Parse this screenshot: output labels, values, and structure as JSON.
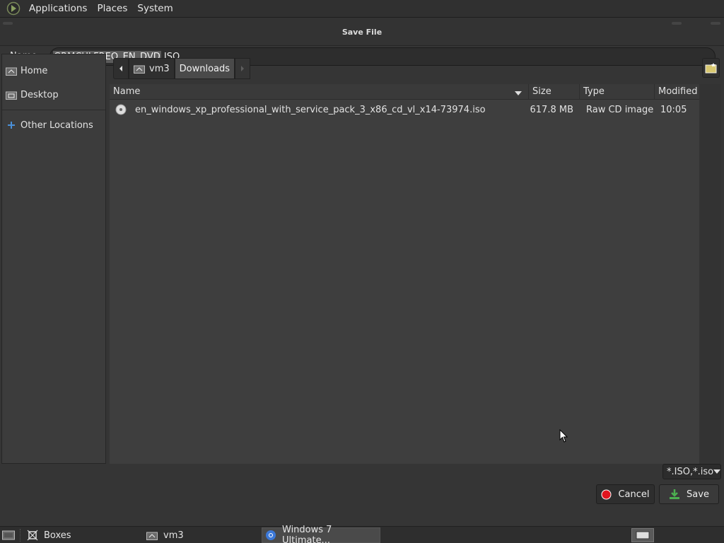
{
  "top_panel": {
    "menus": [
      "Applications",
      "Places",
      "System"
    ]
  },
  "dialog": {
    "title": "Save File",
    "name_label": "Name:",
    "name_value_selected": "GRMCULFREO_EN_DVD",
    "name_value_ext": ".ISO"
  },
  "sidebar": {
    "items": [
      {
        "label": "Home",
        "icon": "home-folder-icon"
      },
      {
        "label": "Desktop",
        "icon": "desktop-folder-icon"
      },
      {
        "label": "Other Locations",
        "icon": "plus-icon"
      }
    ]
  },
  "pathbar": {
    "segments": [
      "vm3",
      "Downloads"
    ]
  },
  "file_list": {
    "columns": [
      "Name",
      "Size",
      "Type",
      "Modified"
    ],
    "rows": [
      {
        "name": "en_windows_xp_professional_with_service_pack_3_x86_cd_vl_x14-73974.iso",
        "size": "617.8 MB",
        "type": "Raw CD image",
        "modified": "10:05"
      }
    ]
  },
  "filter": {
    "selected": "*.ISO,*.iso"
  },
  "buttons": {
    "cancel": "Cancel",
    "save": "Save"
  },
  "taskbar": {
    "items": [
      "Boxes",
      "vm3",
      "Windows 7 Ultimate..."
    ]
  },
  "colors": {
    "background": "#353535",
    "cancel_icon": "#e0141e",
    "save_icon": "#4caf50",
    "other_locations_icon": "#4a90d9"
  }
}
